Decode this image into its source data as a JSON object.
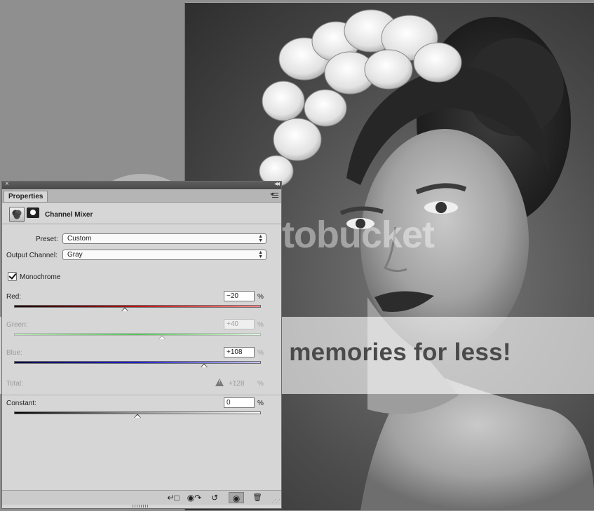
{
  "panel": {
    "tab_label": "Properties",
    "adjustment_title": "Channel Mixer",
    "preset": {
      "label": "Preset:",
      "value": "Custom"
    },
    "output_channel": {
      "label": "Output Channel:",
      "value": "Gray"
    },
    "monochrome": {
      "label": "Monochrome",
      "checked": true
    },
    "channels": [
      {
        "name": "Red:",
        "value": "−20",
        "unit": "%",
        "level_percent": -20,
        "enabled": true,
        "color": "#c01414"
      },
      {
        "name": "Green:",
        "value": "+40",
        "unit": "%",
        "level_percent": 40,
        "enabled": false,
        "color": "#58c458"
      },
      {
        "name": "Blue:",
        "value": "+108",
        "unit": "%",
        "level_percent": 108,
        "enabled": true,
        "color": "#2020d0"
      }
    ],
    "total": {
      "label": "Total:",
      "value": "+128",
      "unit": "%",
      "warning_icon": "warning-icon"
    },
    "constant": {
      "label": "Constant:",
      "value": "0",
      "unit": "%",
      "level_percent": 0
    },
    "footer_buttons": [
      {
        "name": "clip-to-layer-icon",
        "glyph": "↵□"
      },
      {
        "name": "view-previous-state-icon",
        "glyph": "◉↷"
      },
      {
        "name": "reset-icon",
        "glyph": "↺"
      },
      {
        "name": "visibility-eye-icon",
        "glyph": "◉",
        "pressed": true
      },
      {
        "name": "trash-icon",
        "glyph": "🗑"
      }
    ]
  },
  "watermark": {
    "logo": "photobucket",
    "tagline": "Protect more of your memories for less!"
  }
}
